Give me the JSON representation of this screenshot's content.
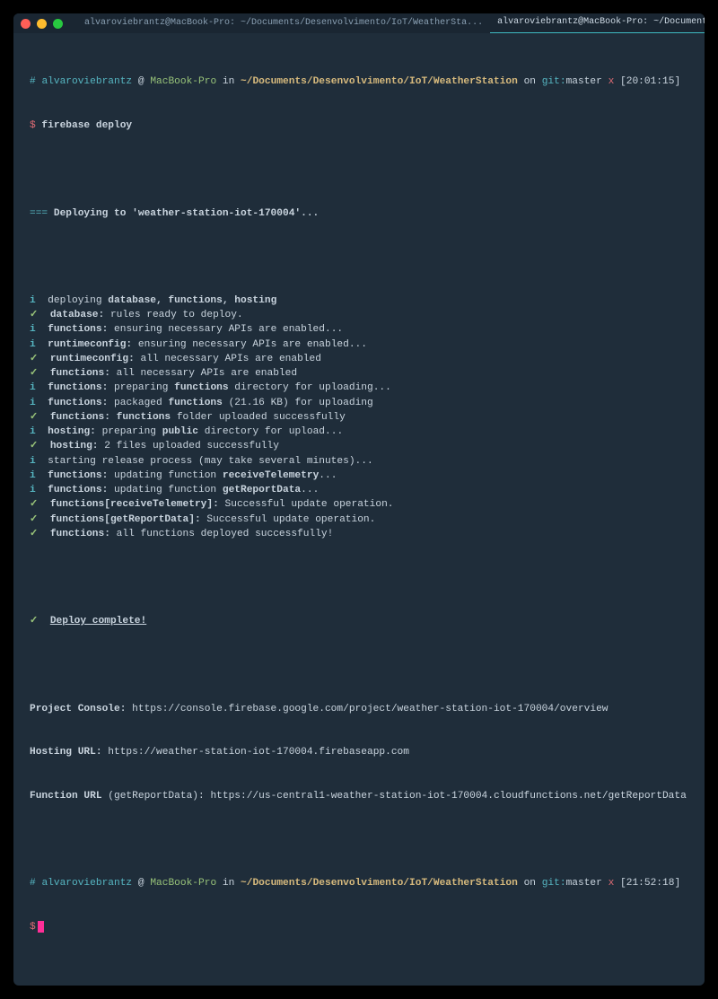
{
  "titlebar": {
    "tabs": [
      "alvaroviebrantz@MacBook-Pro: ~/Documents/Desenvolvimento/IoT/WeatherSta...",
      "alvaroviebrantz@MacBook-Pro: ~/Documents/Desenvolvimento/IoT/WeatherSta..."
    ]
  },
  "colors": {
    "bg": "#1f2d3a",
    "cyan": "#56b6c2",
    "green": "#98c379",
    "yellow": "#d7ba7d",
    "red": "#e06c75",
    "magenta": "#ff2e97"
  },
  "prompt1": {
    "hash": "#",
    "user": "alvaroviebrantz",
    "at": " @ ",
    "host": "MacBook-Pro",
    "in": " in ",
    "path": "~/Documents/Desenvolvimento/IoT/WeatherStation",
    "on": " on ",
    "git": "git:",
    "branch": "master",
    "x": " x",
    "time": " [20:01:15]"
  },
  "cmdline": {
    "sym": "$",
    "cmd": " firebase deploy"
  },
  "deploying": {
    "eq": "=== ",
    "text": "Deploying to 'weather-station-iot-170004'..."
  },
  "lines": [
    {
      "sym": "i",
      "cls": "c-i",
      "pre": "  deploying ",
      "label": "database, functions, hosting",
      "post": ""
    },
    {
      "sym": "✓",
      "cls": "c-chk",
      "pre": "  ",
      "label": "database:",
      "post": " rules ready to deploy."
    },
    {
      "sym": "i",
      "cls": "c-i",
      "pre": "  ",
      "label": "functions:",
      "post": " ensuring necessary APIs are enabled..."
    },
    {
      "sym": "i",
      "cls": "c-i",
      "pre": "  ",
      "label": "runtimeconfig:",
      "post": " ensuring necessary APIs are enabled..."
    },
    {
      "sym": "✓",
      "cls": "c-chk",
      "pre": "  ",
      "label": "runtimeconfig:",
      "post": " all necessary APIs are enabled"
    },
    {
      "sym": "✓",
      "cls": "c-chk",
      "pre": "  ",
      "label": "functions:",
      "post": " all necessary APIs are enabled"
    },
    {
      "sym": "i",
      "cls": "c-i",
      "pre": "  ",
      "label": "functions:",
      "post": " preparing ",
      "label2": "functions",
      "post2": " directory for uploading..."
    },
    {
      "sym": "i",
      "cls": "c-i",
      "pre": "  ",
      "label": "functions:",
      "post": " packaged ",
      "label2": "functions",
      "post2": " (21.16 KB) for uploading"
    },
    {
      "sym": "✓",
      "cls": "c-chk",
      "pre": "  ",
      "label": "functions:",
      "post": " ",
      "label2": "functions",
      "post2": " folder uploaded successfully"
    },
    {
      "sym": "i",
      "cls": "c-i",
      "pre": "  ",
      "label": "hosting:",
      "post": " preparing ",
      "label2": "public",
      "post2": " directory for upload..."
    },
    {
      "sym": "✓",
      "cls": "c-chk",
      "pre": "  ",
      "label": "hosting:",
      "post": " 2 files uploaded successfully"
    },
    {
      "sym": "i",
      "cls": "c-i",
      "pre": "  starting release process (may take several minutes)...",
      "label": "",
      "post": ""
    },
    {
      "sym": "i",
      "cls": "c-i",
      "pre": "  ",
      "label": "functions:",
      "post": " updating function ",
      "label2": "receiveTelemetry",
      "post2": "..."
    },
    {
      "sym": "i",
      "cls": "c-i",
      "pre": "  ",
      "label": "functions:",
      "post": " updating function ",
      "label2": "getReportData",
      "post2": "..."
    },
    {
      "sym": "✓",
      "cls": "c-chk",
      "pre": "  ",
      "label": "functions[receiveTelemetry]:",
      "post": " Successful update operation."
    },
    {
      "sym": "✓",
      "cls": "c-chk",
      "pre": "  ",
      "label": "functions[getReportData]:",
      "post": " Successful update operation."
    },
    {
      "sym": "✓",
      "cls": "c-chk",
      "pre": "  ",
      "label": "functions:",
      "post": " all functions deployed successfully!"
    }
  ],
  "complete": {
    "sym": "✓",
    "text": "Deploy complete!"
  },
  "urls": {
    "console_label": "Project Console:",
    "console_url": " https://console.firebase.google.com/project/weather-station-iot-170004/overview",
    "hosting_label": "Hosting URL:",
    "hosting_url": " https://weather-station-iot-170004.firebaseapp.com",
    "function_label": "Function URL",
    "function_paren": " (getReportData): ",
    "function_url": "https://us-central1-weather-station-iot-170004.cloudfunctions.net/getReportData"
  },
  "prompt2": {
    "hash": "#",
    "user": "alvaroviebrantz",
    "at": " @ ",
    "host": "MacBook-Pro",
    "in": " in ",
    "path": "~/Documents/Desenvolvimento/IoT/WeatherStation",
    "on": " on ",
    "git": "git:",
    "branch": "master",
    "x": " x",
    "time": " [21:52:18]"
  },
  "cmdline2": {
    "sym": "$"
  }
}
